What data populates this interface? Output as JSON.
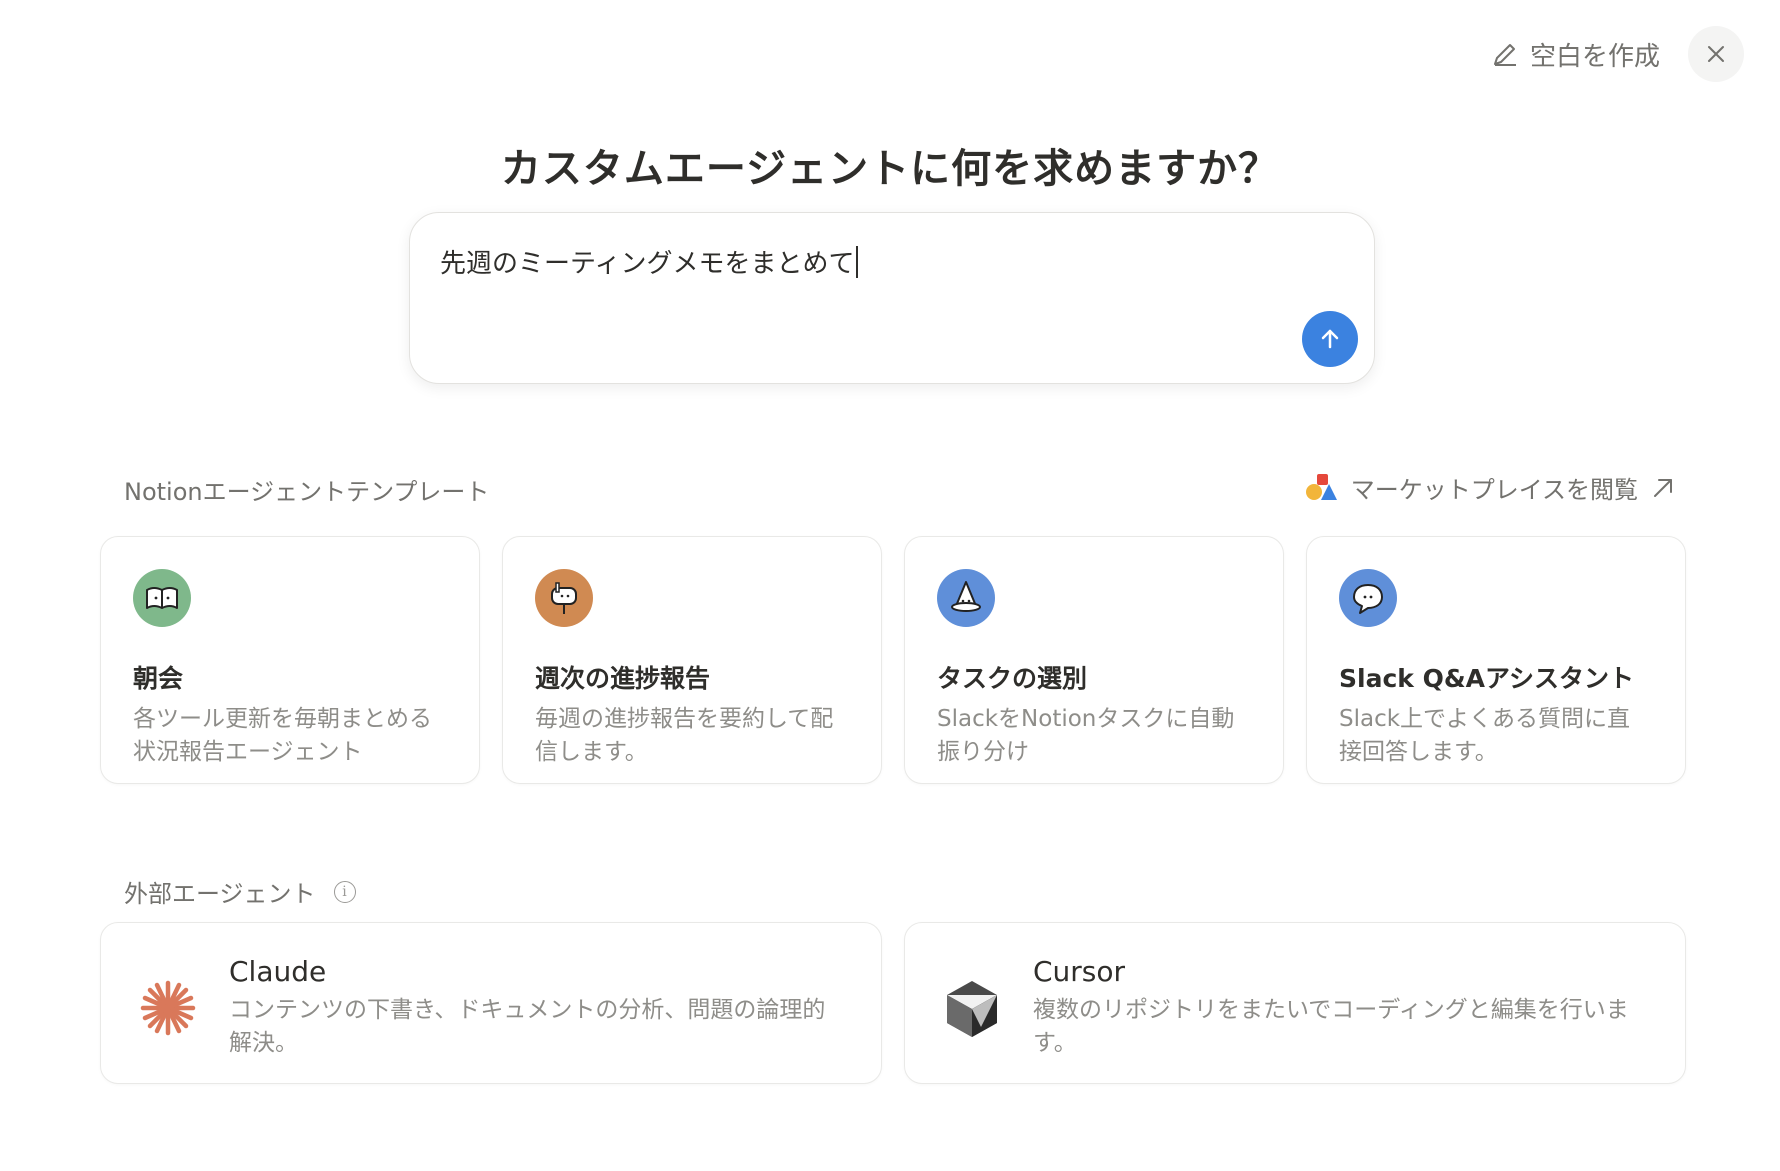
{
  "header": {
    "blank_label": "空白を作成"
  },
  "headline": "カスタムエージェントに何を求めますか？",
  "prompt": {
    "value": "先週のミーティングメモをまとめて"
  },
  "templates_section": {
    "title": "Notionエージェントテンプレート",
    "marketplace_label": "マーケットプレイスを閲覧",
    "items": [
      {
        "title": "朝会",
        "desc": "各ツール更新を毎朝まとめる状況報告エージェント",
        "icon": "book-icon",
        "color": "#7fb88b"
      },
      {
        "title": "週次の進捗報告",
        "desc": "毎週の進捗報告を要約して配信します。",
        "icon": "mailbox-icon",
        "color": "#d08a52"
      },
      {
        "title": "タスクの選別",
        "desc": "SlackをNotionタスクに自動振り分け",
        "icon": "witch-hat-icon",
        "color": "#5f8fd9"
      },
      {
        "title": "Slack Q&Aアシスタント",
        "desc": "Slack上でよくある質問に直接回答します。",
        "icon": "speech-bubble-icon",
        "color": "#5f8fd9"
      }
    ]
  },
  "external_section": {
    "title": "外部エージェント",
    "items": [
      {
        "title": "Claude",
        "desc": "コンテンツの下書き、ドキュメントの分析、問題の論理的解決。",
        "icon": "claude-icon",
        "color": "#d9785a"
      },
      {
        "title": "Cursor",
        "desc": "複数のリポジトリをまたいでコーディングと編集を行います。",
        "icon": "cursor-icon",
        "color": "#3a3a3a"
      }
    ]
  }
}
